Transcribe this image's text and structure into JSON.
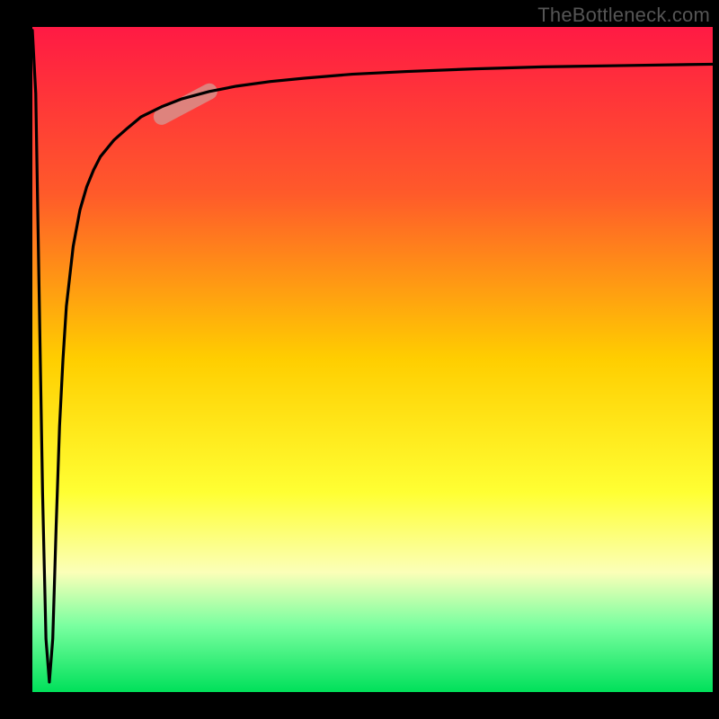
{
  "watermark": "TheBottleneck.com",
  "chart_data": {
    "type": "line",
    "title": "",
    "xlabel": "",
    "ylabel": "",
    "xlim": [
      0,
      100
    ],
    "ylim": [
      0,
      100
    ],
    "background_gradient": {
      "stops": [
        {
          "offset": 0.0,
          "color": "#ff1a44"
        },
        {
          "offset": 0.25,
          "color": "#ff5a2a"
        },
        {
          "offset": 0.5,
          "color": "#ffce00"
        },
        {
          "offset": 0.7,
          "color": "#ffff33"
        },
        {
          "offset": 0.82,
          "color": "#fbffb8"
        },
        {
          "offset": 0.9,
          "color": "#7affa0"
        },
        {
          "offset": 1.0,
          "color": "#00e05a"
        }
      ]
    },
    "series": [
      {
        "name": "bottleneck-curve",
        "color": "#000000",
        "x": [
          0.0,
          0.5,
          1.0,
          1.5,
          2.0,
          2.5,
          3.0,
          3.5,
          4.0,
          4.5,
          5.0,
          6.0,
          7.0,
          8.0,
          9.0,
          10.0,
          12.0,
          14.0,
          16.0,
          19.0,
          22.0,
          26.0,
          30.0,
          35.0,
          40.0,
          47.0,
          55.0,
          65.0,
          75.0,
          87.0,
          100.0
        ],
        "y": [
          99.5,
          90.0,
          60.0,
          30.0,
          8.0,
          1.5,
          8.0,
          25.0,
          40.0,
          50.0,
          58.0,
          67.0,
          72.5,
          76.0,
          78.5,
          80.5,
          83.0,
          84.8,
          86.5,
          88.0,
          89.2,
          90.3,
          91.1,
          91.8,
          92.3,
          92.9,
          93.3,
          93.7,
          94.0,
          94.2,
          94.4
        ]
      }
    ],
    "highlight": {
      "name": "curve-highlight-pill",
      "color": "#d9908a",
      "x_range": [
        19.0,
        26.0
      ],
      "y_range": [
        86.5,
        90.3
      ]
    }
  }
}
